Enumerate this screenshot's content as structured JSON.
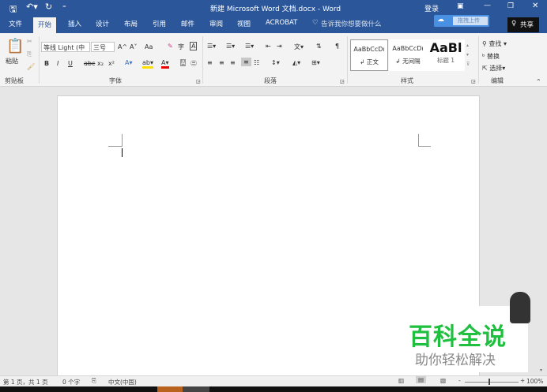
{
  "titlebar": {
    "title": "新建 Microsoft Word 文档.docx  -  Word",
    "login": "登录",
    "save_icon": "save-icon",
    "undo_icon": "undo-icon",
    "redo_icon": "redo-icon"
  },
  "tabs": [
    {
      "label": "文件"
    },
    {
      "label": "开始"
    },
    {
      "label": "插入"
    },
    {
      "label": "设计"
    },
    {
      "label": "布局"
    },
    {
      "label": "引用"
    },
    {
      "label": "邮件"
    },
    {
      "label": "审阅"
    },
    {
      "label": "视图"
    },
    {
      "label": "ACROBAT"
    }
  ],
  "tell_me": "告诉我你想要做什么",
  "upload_label": "拖拽上传",
  "share_label": "共享",
  "clipboard": {
    "paste": "粘贴",
    "group": "剪贴板"
  },
  "font": {
    "name": "等线 Light (中",
    "size": "三号",
    "group": "字体",
    "bold": "B",
    "italic": "I",
    "underline": "U",
    "strike": "abc",
    "sub": "x₂",
    "sup": "x²",
    "grow": "A^",
    "shrink": "A˅",
    "case": "Aa"
  },
  "paragraph": {
    "group": "段落"
  },
  "styles": {
    "group": "样式",
    "items": [
      {
        "preview": "AaBbCcDı",
        "name": "↲ 正文"
      },
      {
        "preview": "AaBbCcDı",
        "name": "↲ 无间隔"
      },
      {
        "preview": "AaBl",
        "name": "标题 1"
      }
    ]
  },
  "editing": {
    "group": "编辑",
    "find": "查找",
    "replace": "替换",
    "select": "选择"
  },
  "status": {
    "page": "第 1 页，共 1 页",
    "words": "0 个字",
    "lang": "中文(中国)",
    "zoom": "100%"
  },
  "watermark": {
    "title": "百科全说",
    "subtitle": "助你轻松解决"
  }
}
